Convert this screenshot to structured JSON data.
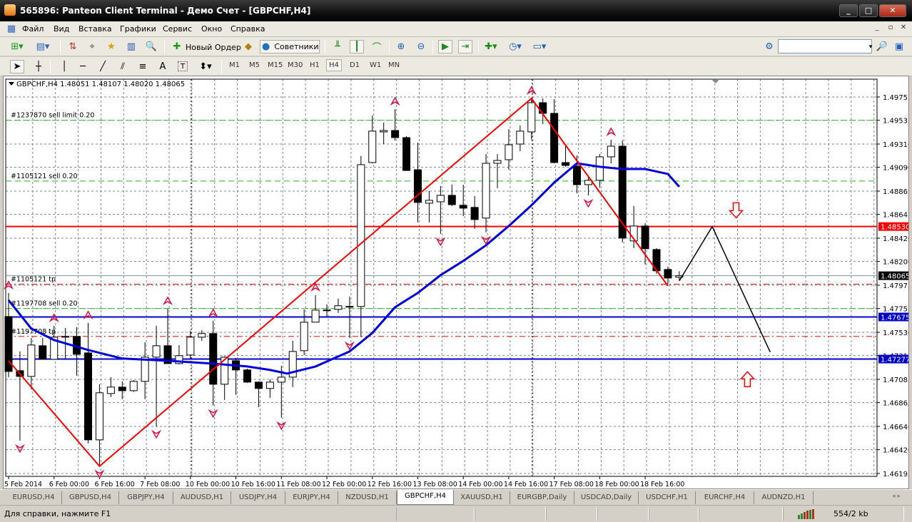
{
  "window": {
    "title": "565896: Panteon Client Terminal - Демо Счет - [GBPCHF,H4]",
    "minimize": "_",
    "maximize": "□",
    "close": "✕"
  },
  "menu": [
    "Файл",
    "Вид",
    "Вставка",
    "Графики",
    "Сервис",
    "Окно",
    "Справка"
  ],
  "mdi": [
    "_",
    "▫",
    "✕"
  ],
  "toolbar": {
    "new_order": "Новый Ордер",
    "experts": "Советники"
  },
  "timeframes": [
    "M1",
    "M5",
    "M15",
    "M30",
    "H1",
    "H4",
    "D1",
    "W1",
    "MN"
  ],
  "active_timeframe": "H4",
  "drawing_tools": {
    "text": "A",
    "label": "T"
  },
  "search": {
    "value": ""
  },
  "chart": {
    "header": "GBPCHF,H4  1.48051 1.48107 1.48020 1.48065",
    "price_ticks": [
      "1.49755",
      "1.49535",
      "1.49310",
      "1.49090",
      "1.48865",
      "1.48645",
      "1.48420",
      "1.48200",
      "1.47975",
      "1.47755",
      "1.47530",
      "1.47310",
      "1.47085",
      "1.46865",
      "1.46640",
      "1.46420",
      "1.46195"
    ],
    "time_labels": [
      "5 Feb 2014",
      "6 Feb 00:00",
      "6 Feb 16:00",
      "7 Feb 08:00",
      "10 Feb 00:00",
      "10 Feb 16:00",
      "11 Feb 08:00",
      "12 Feb 00:00",
      "12 Feb 16:00",
      "13 Feb 08:00",
      "14 Feb 00:00",
      "14 Feb 16:00",
      "17 Feb 08:00",
      "18 Feb 00:00",
      "18 Feb 16:00"
    ],
    "levels": [
      {
        "label": "#1237870 sell limit 0.20",
        "price": 1.49535,
        "color": "#22bb22",
        "style": "dash"
      },
      {
        "label": "#1105121 sell 0.20",
        "price": 1.4896,
        "color": "#22bb22",
        "style": "dash"
      },
      {
        "label": "",
        "price": 1.4853,
        "color": "#ff0000",
        "style": "solid",
        "tag": "1.48530"
      },
      {
        "label": "",
        "price": 1.48065,
        "color": "#8090a0",
        "style": "thin",
        "tag": "1.48065",
        "tagColor": "#000000"
      },
      {
        "label": "#1105121 tp",
        "price": 1.47985,
        "color": "#ff0000",
        "style": "dashdot"
      },
      {
        "label": "#1197708 sell 0.20",
        "price": 1.47755,
        "color": "#22bb22",
        "style": "dash"
      },
      {
        "label": "",
        "price": 1.47675,
        "color": "#0000cc",
        "style": "solid",
        "tag": "1.47675"
      },
      {
        "label": "#1197708 tp",
        "price": 1.47491,
        "color": "#ff0000",
        "style": "dashdot"
      },
      {
        "label": "",
        "price": 1.47277,
        "color": "#0000cc",
        "style": "solid",
        "tag": "1.47277"
      }
    ]
  },
  "chart_data": {
    "type": "candlestick",
    "symbol": "GBPCHF",
    "timeframe": "H4",
    "ylim": [
      1.4615,
      1.4992
    ],
    "ohlc": [
      [
        1.47679,
        1.47902,
        1.47106,
        1.4716
      ],
      [
        1.47167,
        1.47349,
        1.46506,
        1.47113
      ],
      [
        1.47113,
        1.47477,
        1.46992,
        1.4741
      ],
      [
        1.47403,
        1.47477,
        1.47275,
        1.47275
      ],
      [
        1.47275,
        1.47592,
        1.47275,
        1.47484
      ],
      [
        1.47484,
        1.47571,
        1.47275,
        1.47491
      ],
      [
        1.47491,
        1.47578,
        1.4712,
        1.47322
      ],
      [
        1.47335,
        1.47619,
        1.4648,
        1.46513
      ],
      [
        1.46513,
        1.47039,
        1.46264,
        1.46958
      ],
      [
        1.46951,
        1.47106,
        1.46918,
        1.47012
      ],
      [
        1.47012,
        1.47066,
        1.46897,
        1.46978
      ],
      [
        1.46978,
        1.47079,
        1.46965,
        1.47066
      ],
      [
        1.47066,
        1.47437,
        1.46897,
        1.47295
      ],
      [
        1.47295,
        1.47592,
        1.46641,
        1.47403
      ],
      [
        1.47403,
        1.47753,
        1.47234,
        1.47234
      ],
      [
        1.47234,
        1.4741,
        1.47228,
        1.47309
      ],
      [
        1.47315,
        1.47544,
        1.47282,
        1.47484
      ],
      [
        1.47484,
        1.47551,
        1.4745,
        1.47518
      ],
      [
        1.47518,
        1.47639,
        1.46837,
        1.47039
      ],
      [
        1.47039,
        1.47302,
        1.46891,
        1.47295
      ],
      [
        1.47261,
        1.47288,
        1.46938,
        1.47174
      ],
      [
        1.47174,
        1.47187,
        1.47052,
        1.47059
      ],
      [
        1.47059,
        1.47066,
        1.46823,
        1.46999
      ],
      [
        1.46999,
        1.47086,
        1.46911,
        1.47059
      ],
      [
        1.47059,
        1.47214,
        1.46722,
        1.47106
      ],
      [
        1.47106,
        1.4745,
        1.47012,
        1.47349
      ],
      [
        1.47356,
        1.47746,
        1.47315,
        1.47626
      ],
      [
        1.47626,
        1.47881,
        1.47626,
        1.4774
      ],
      [
        1.4774,
        1.47794,
        1.47679,
        1.47741
      ],
      [
        1.47747,
        1.47848,
        1.47713,
        1.47781
      ],
      [
        1.47774,
        1.47868,
        1.47477,
        1.47775
      ],
      [
        1.47774,
        1.49196,
        1.47484,
        1.49115
      ],
      [
        1.49135,
        1.4958,
        1.49128,
        1.49432
      ],
      [
        1.49425,
        1.49512,
        1.4931,
        1.49438
      ],
      [
        1.49438,
        1.4964,
        1.49344,
        1.49371
      ],
      [
        1.49371,
        1.49384,
        1.4906,
        1.4906
      ],
      [
        1.49067,
        1.49324,
        1.48569,
        1.48758
      ],
      [
        1.48751,
        1.48865,
        1.48569,
        1.48778
      ],
      [
        1.48764,
        1.48913,
        1.48461,
        1.48825
      ],
      [
        1.48825,
        1.48926,
        1.48724,
        1.48737
      ],
      [
        1.48731,
        1.48926,
        1.48629,
        1.48704
      ],
      [
        1.48711,
        1.48818,
        1.48508,
        1.48596
      ],
      [
        1.4861,
        1.49216,
        1.48475,
        1.49128
      ],
      [
        1.49128,
        1.49216,
        1.48892,
        1.49155
      ],
      [
        1.49162,
        1.49452,
        1.49067,
        1.49303
      ],
      [
        1.4931,
        1.49486,
        1.49243,
        1.49432
      ],
      [
        1.49425,
        1.49742,
        1.49351,
        1.49701
      ],
      [
        1.49701,
        1.49742,
        1.49499,
        1.496
      ],
      [
        1.496,
        1.49735,
        1.49128,
        1.49135
      ],
      [
        1.49135,
        1.49297,
        1.49095,
        1.49108
      ],
      [
        1.49101,
        1.49202,
        1.48845,
        1.48926
      ],
      [
        1.48926,
        1.48993,
        1.48825,
        1.48967
      ],
      [
        1.48967,
        1.49216,
        1.48899,
        1.49189
      ],
      [
        1.49189,
        1.49351,
        1.49128,
        1.4929
      ],
      [
        1.4929,
        1.49344,
        1.4838,
        1.48421
      ],
      [
        1.48394,
        1.48724,
        1.48326,
        1.48535
      ],
      [
        1.48535,
        1.48562,
        1.48171,
        1.4832
      ],
      [
        1.48313,
        1.48326,
        1.48084,
        1.48111
      ],
      [
        1.48124,
        1.48151,
        1.47983,
        1.48043
      ],
      [
        1.48051,
        1.48107,
        1.4802,
        1.48065
      ]
    ],
    "moving_average": [
      [
        0,
        1.47834
      ],
      [
        2,
        1.47565
      ],
      [
        4,
        1.47457
      ],
      [
        7,
        1.47363
      ],
      [
        10,
        1.47282
      ],
      [
        14,
        1.47261
      ],
      [
        18,
        1.47234
      ],
      [
        21,
        1.47207
      ],
      [
        23,
        1.47174
      ],
      [
        24.5,
        1.4714
      ],
      [
        27,
        1.47207
      ],
      [
        30,
        1.47349
      ],
      [
        32,
        1.47524
      ],
      [
        34,
        1.47767
      ],
      [
        36,
        1.47902
      ],
      [
        38,
        1.4807
      ],
      [
        40,
        1.48205
      ],
      [
        42,
        1.48353
      ],
      [
        44,
        1.48535
      ],
      [
        46,
        1.48731
      ],
      [
        48,
        1.48946
      ],
      [
        50,
        1.49128
      ],
      [
        52,
        1.49095
      ],
      [
        54,
        1.49074
      ],
      [
        56,
        1.49074
      ],
      [
        58,
        1.49027
      ],
      [
        59,
        1.48906
      ]
    ],
    "zigzag": [
      [
        0,
        1.47261
      ],
      [
        8,
        1.46264
      ],
      [
        46,
        1.49742
      ],
      [
        58,
        1.47969
      ]
    ],
    "forecast": [
      [
        59,
        1.48016
      ],
      [
        61.9,
        1.4853
      ],
      [
        67,
        1.47342
      ]
    ],
    "fractals_up": [
      0,
      4,
      7,
      14,
      18,
      27,
      34,
      46,
      53
    ],
    "fractals_down": [
      1,
      8,
      13,
      18,
      24,
      30,
      38,
      42,
      51
    ],
    "period_separators": [
      16,
      46
    ],
    "signal_arrows": [
      {
        "dir": "down",
        "index": 64,
        "price": 1.4868
      },
      {
        "dir": "up",
        "index": 65,
        "price": 1.4709
      }
    ]
  },
  "tabs": [
    "EURUSD,H4",
    "GBPUSD,H4",
    "GBPJPY,H4",
    "AUDUSD,H1",
    "USDJPY,H4",
    "EURJPY,H4",
    "NZDUSD,H1",
    "GBPCHF,H4",
    "XAUUSD,H1",
    "EURGBP,Daily",
    "USDCAD,Daily",
    "USDCHF,H1",
    "EURCHF,H4",
    "AUDNZD,H1"
  ],
  "active_tab": "GBPCHF,H4",
  "status": {
    "help": "Для справки, нажмите F1",
    "traffic": "554/2 kb"
  },
  "colors": {
    "bull": "#ffffff",
    "bear": "#000000",
    "ma": "#0000dd",
    "zigzag": "#ff0000",
    "fractal": "#dd1144",
    "grid": "#708090"
  }
}
